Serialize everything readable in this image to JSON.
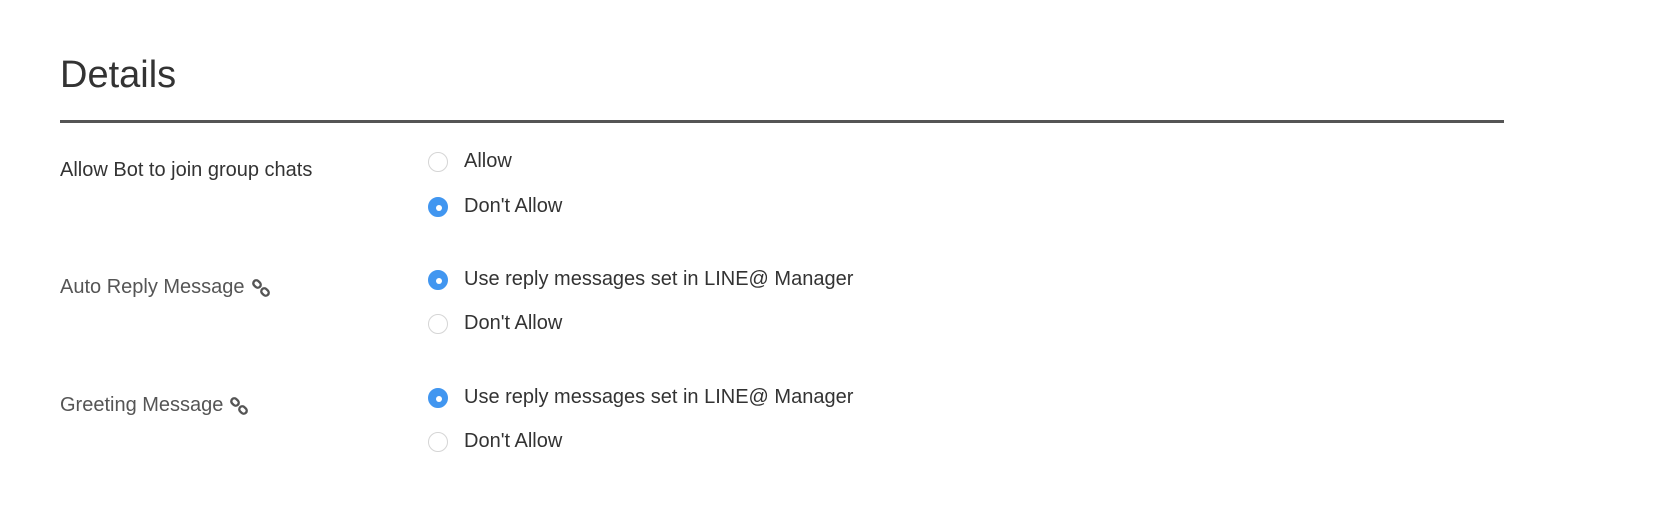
{
  "title": "Details",
  "accent_color": "#4196f0",
  "settings": [
    {
      "label": "Allow Bot to join group chats",
      "has_link_icon": false,
      "options": [
        {
          "label": "Allow",
          "selected": false
        },
        {
          "label": "Don't Allow",
          "selected": true
        }
      ]
    },
    {
      "label": "Auto Reply Message",
      "has_link_icon": true,
      "icon": "link-icon",
      "options": [
        {
          "label": "Use reply messages set in LINE@ Manager",
          "selected": true
        },
        {
          "label": "Don't Allow",
          "selected": false
        }
      ]
    },
    {
      "label": "Greeting Message",
      "has_link_icon": true,
      "icon": "link-icon",
      "options": [
        {
          "label": "Use reply messages set in LINE@ Manager",
          "selected": true
        },
        {
          "label": "Don't Allow",
          "selected": false
        }
      ]
    }
  ]
}
